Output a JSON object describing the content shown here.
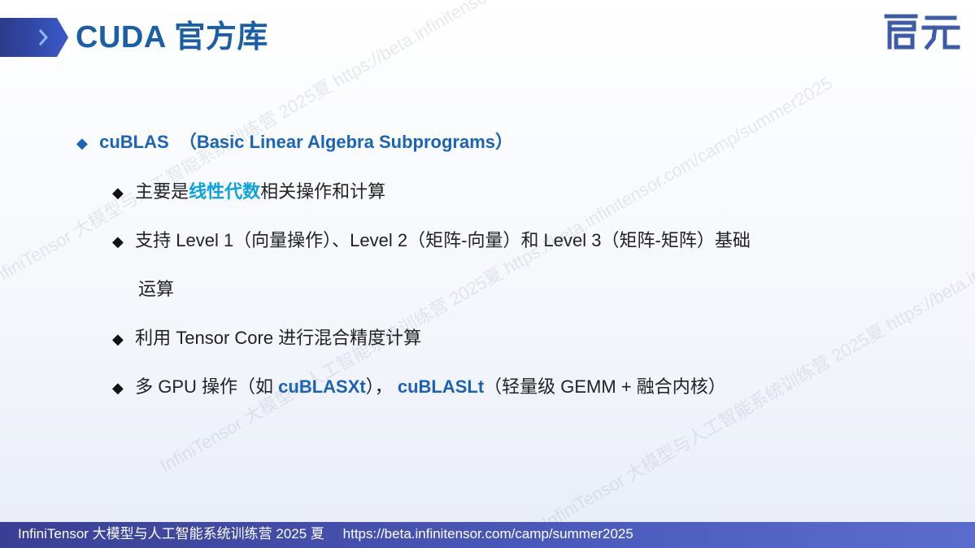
{
  "title": "CUDA 官方库",
  "logo_text": "启元",
  "watermark": "InfiniTensor 大模型与人工智能系统训练营 2025夏 https://beta.infinitensor.com/camp/summer2025",
  "heading": {
    "name": "cuBLAS",
    "desc": "（Basic Linear Algebra Subprograms）"
  },
  "bullets": {
    "b1": {
      "pre": "主要是",
      "highlight": "线性代数",
      "post": "相关操作和计算"
    },
    "b2": {
      "line1": "支持 Level 1（向量操作）、Level 2（矩阵-向量）和 Level 3（矩阵-矩阵）基础",
      "line2": "运算"
    },
    "b3": {
      "text": "利用 Tensor Core 进行混合精度计算"
    },
    "b4": {
      "pre": "多 GPU 操作（如 ",
      "hl1": "cuBLASXt",
      "mid": "）， ",
      "hl2": "cuBLASLt",
      "post": "（轻量级 GEMM + 融合内核）"
    }
  },
  "footer": {
    "camp": "InfiniTensor 大模型与人工智能系统训练营 2025 夏",
    "url": "https://beta.infinitensor.com/camp/summer2025"
  },
  "colors": {
    "title": "#1b5ea8",
    "accent": "#1b63b5",
    "highlight": "#0aa3df",
    "footer": "#3a3f94"
  }
}
